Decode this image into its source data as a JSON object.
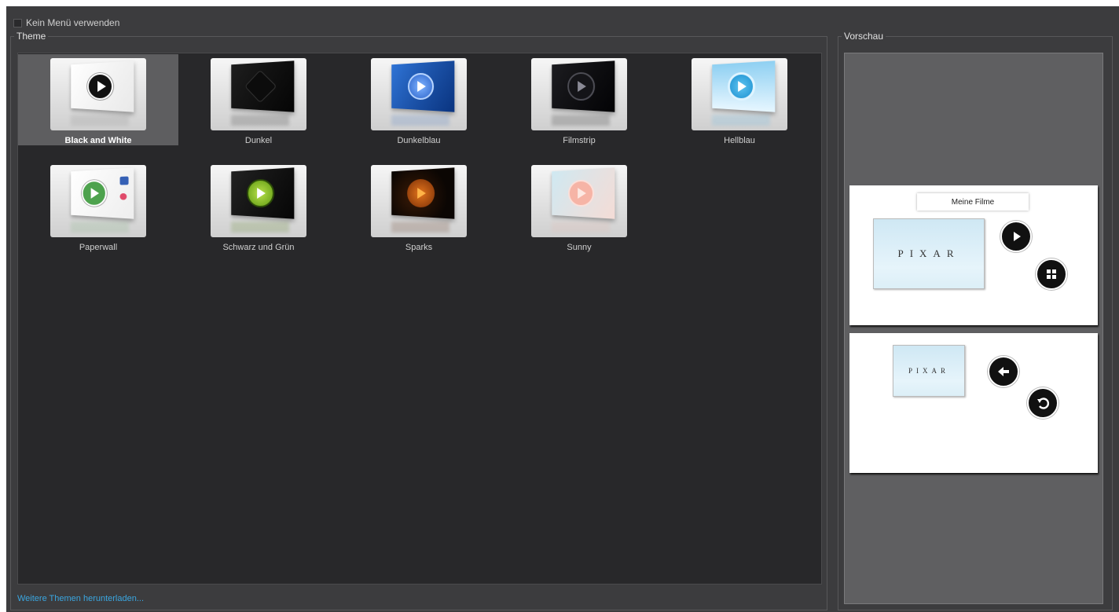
{
  "top_checkbox": {
    "label": "Kein Menü verwenden",
    "checked": false
  },
  "theme_group": {
    "title": "Theme",
    "tiles": [
      {
        "label": "Black and White",
        "selected": true
      },
      {
        "label": "Dunkel",
        "selected": false
      },
      {
        "label": "Dunkelblau",
        "selected": false
      },
      {
        "label": "Filmstrip",
        "selected": false
      },
      {
        "label": "Hellblau",
        "selected": false
      },
      {
        "label": "Paperwall",
        "selected": false
      },
      {
        "label": "Schwarz und Grün",
        "selected": false
      },
      {
        "label": "Sparks",
        "selected": false
      },
      {
        "label": "Sunny",
        "selected": false
      }
    ],
    "download_link": "Weitere Themen herunterladen..."
  },
  "preview_group": {
    "title": "Vorschau",
    "menu_title": "Meine Filme",
    "movie_logo": "PIXAR",
    "buttons": [
      "play-icon",
      "chapters-icon",
      "back-arrow-icon",
      "return-icon"
    ]
  },
  "colors": {
    "background": "#3c3c3e",
    "list_background": "#28282a",
    "selection": "#5e5e60",
    "link": "#3aa6e0"
  }
}
